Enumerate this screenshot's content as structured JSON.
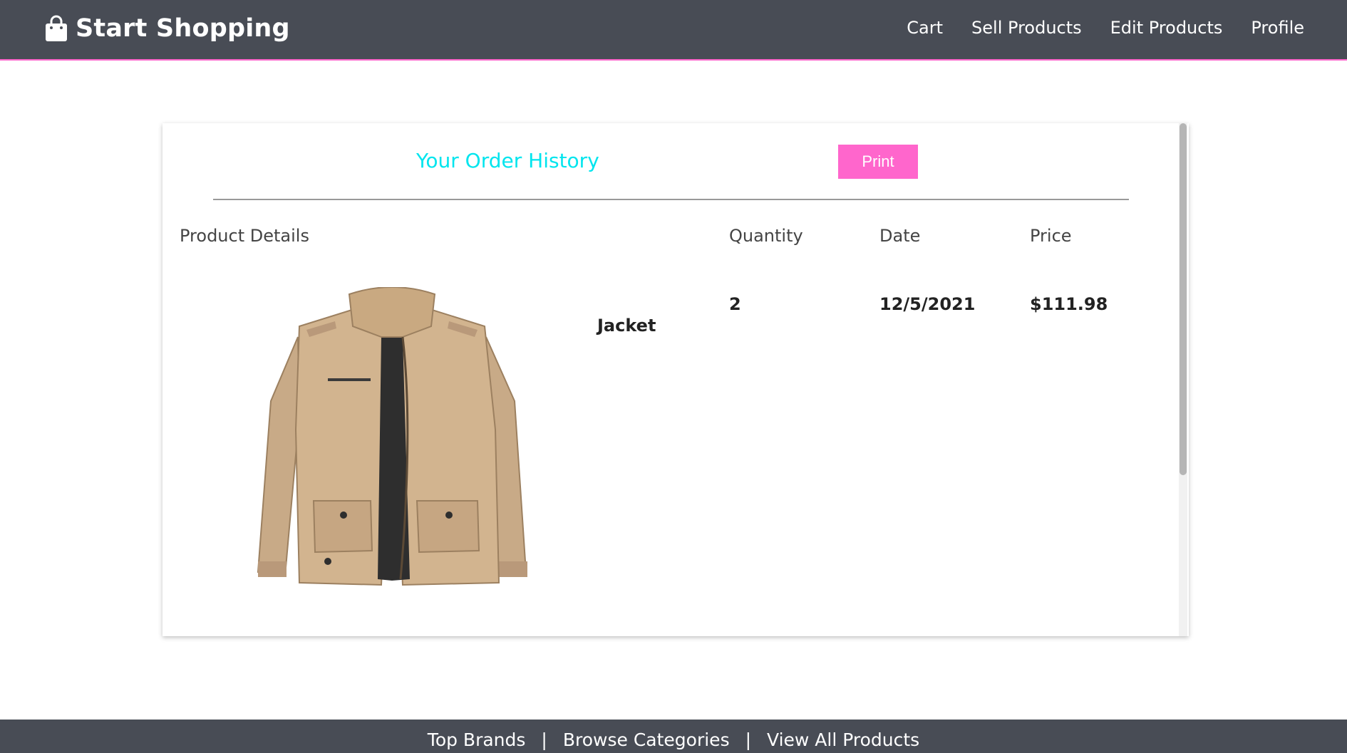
{
  "header": {
    "brand": "Start Shopping",
    "brand_icon": "shopping-bag-icon",
    "nav": [
      {
        "label": "Cart"
      },
      {
        "label": "Sell Products"
      },
      {
        "label": "Edit Products"
      },
      {
        "label": "Profile"
      }
    ]
  },
  "order_history": {
    "title": "Your Order History",
    "print_label": "Print",
    "columns": {
      "product": "Product Details",
      "quantity": "Quantity",
      "date": "Date",
      "price": "Price"
    },
    "rows": [
      {
        "product_name": "Jacket",
        "product_image": "khaki-jacket",
        "quantity": "2",
        "date": "12/5/2021",
        "price": "$111.98"
      }
    ]
  },
  "footer": {
    "links": [
      {
        "label": "Top Brands"
      },
      {
        "label": "Browse Categories"
      },
      {
        "label": "View All Products"
      }
    ],
    "separator": "|"
  },
  "colors": {
    "nav_bg": "#484c55",
    "accent_pink": "#ff66cc",
    "title_cyan": "#00e5ee"
  }
}
